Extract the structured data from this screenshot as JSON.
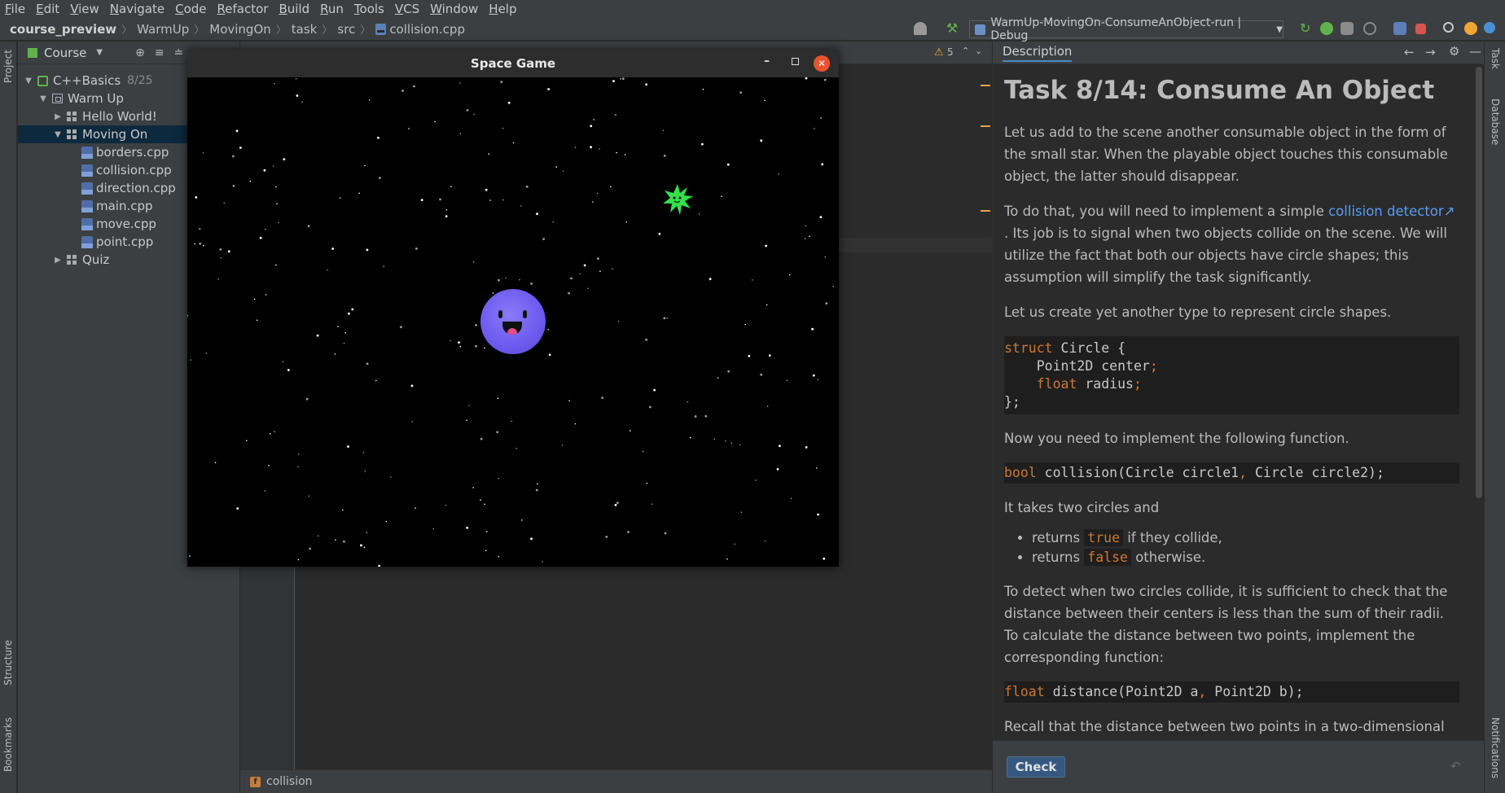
{
  "menu": [
    "File",
    "Edit",
    "View",
    "Navigate",
    "Code",
    "Refactor",
    "Build",
    "Run",
    "Tools",
    "VCS",
    "Window",
    "Help"
  ],
  "breadcrumb": [
    "course_preview",
    "WarmUp",
    "MovingOn",
    "task",
    "src",
    "collision.cpp"
  ],
  "run_config": "WarmUp-MovingOn-ConsumeAnObject-run | Debug",
  "left_strip": {
    "project": "Project",
    "structure": "Structure",
    "bookmarks": "Bookmarks"
  },
  "right_strip": {
    "task": "Task",
    "database": "Database",
    "notifications": "Notifications"
  },
  "project_panel": {
    "title": "Course",
    "tree": [
      {
        "label": "C++Basics",
        "extra": "8/25"
      },
      {
        "label": "Warm Up"
      },
      {
        "label": "Hello World!"
      },
      {
        "label": "Moving On"
      },
      {
        "label": "borders.cpp"
      },
      {
        "label": "collision.cpp"
      },
      {
        "label": "direction.cpp"
      },
      {
        "label": "main.cpp"
      },
      {
        "label": "move.cpp"
      },
      {
        "label": "point.cpp"
      },
      {
        "label": "Quiz"
      }
    ]
  },
  "editor": {
    "warnings": "5",
    "function_crumb": "collision"
  },
  "game_window": {
    "title": "Space Game"
  },
  "description": {
    "tab": "Description",
    "title": "Task 8/14: Consume An Object",
    "p1": "Let us add to the scene another consumable object in the form of the small star. When the playable object touches this consumable object, the latter should disappear.",
    "p2_before": "To do that, you will need to implement a simple ",
    "p2_link": "collision detector",
    "p2_after": " . Its job is to signal when two objects collide on the scene. We will utilize the fact that both our objects have circle shapes; this assumption will simplify the task significantly.",
    "p3": "Let us create yet another type to represent circle shapes.",
    "code1": {
      "l1_kw": "struct",
      "l1": " Circle {",
      "l2": "    Point2D center",
      "l3_kw": "float",
      "l3": " radius",
      "l4": "};"
    },
    "p4": "Now you need to implement the following function.",
    "code2": {
      "kw": "bool",
      "rest": " collision(Circle circle1",
      "rest2": " Circle circle2);"
    },
    "p5": "It takes two circles and",
    "li1_pre": "returns ",
    "li1_code": "true",
    "li1_post": " if they collide,",
    "li2_pre": "returns ",
    "li2_code": "false",
    "li2_post": " otherwise.",
    "p6": "To detect when two circles collide, it is sufficient to check that the distance between their centers is less than the sum of their radii. To calculate the distance between two points, implement the corresponding function:",
    "code3": {
      "kw": "float",
      "rest": " distance(Point2D a",
      "rest2": " Point2D b);"
    },
    "p7": "Recall that the distance between two points in a two-dimensional space",
    "check_label": "Check"
  },
  "colors": {
    "accent": "#589df6",
    "selection": "#0d293e",
    "player": "#6f5cf0",
    "star": "#33e04a",
    "close_btn": "#e9542c"
  }
}
